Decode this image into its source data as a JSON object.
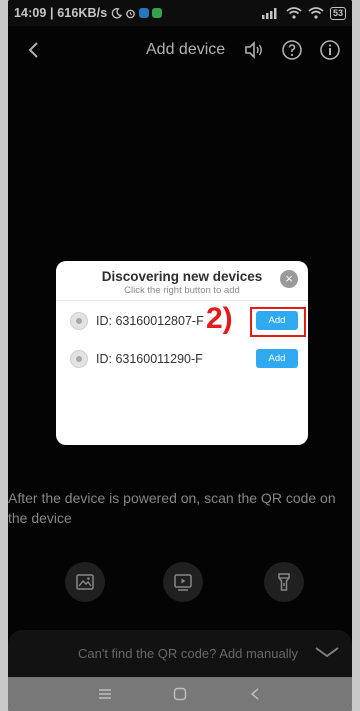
{
  "status_bar": {
    "time_speed": "14:09 | 616KB/s",
    "battery": "53",
    "app_colors": [
      "#2b8de0",
      "#3cc15a"
    ]
  },
  "header": {
    "title": "Add device",
    "icons": [
      "back-icon",
      "speaker-icon",
      "help-icon",
      "info-icon"
    ]
  },
  "dialog": {
    "title": "Discovering new devices",
    "subtitle": "Click the right button to add",
    "close_symbol": "×",
    "devices": [
      {
        "id": "ID: 63160012807-F",
        "button": "Add"
      },
      {
        "id": "ID: 63160011290-F",
        "button": "Add"
      }
    ],
    "annotation": "2)",
    "accent_color": "#2faaf0",
    "annotation_color": "#e41b1b"
  },
  "main": {
    "hint": "After the device is powered on, scan the QR code on the device",
    "tools": [
      "gallery-icon",
      "playback-icon",
      "flashlight-icon"
    ]
  },
  "bottom_bar": {
    "text": "Can't find the QR code? Add manually"
  },
  "navbar": {
    "items": [
      "menu-icon",
      "home-icon",
      "back-icon"
    ]
  }
}
